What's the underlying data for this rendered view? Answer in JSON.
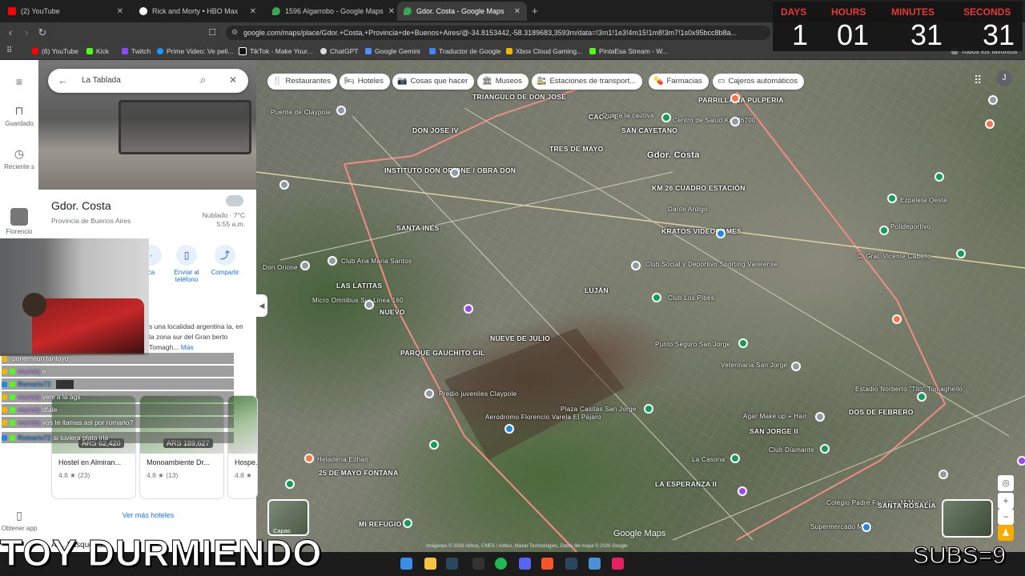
{
  "tabs": [
    {
      "title": "(2) YouTube",
      "color": "#ff0000"
    },
    {
      "title": "Rick and Morty • HBO Max",
      "color": "#ffffff"
    },
    {
      "title": "1596 Algarrobo - Google Maps",
      "color": "#34a853"
    },
    {
      "title": "Gdor. Costa - Google Maps",
      "color": "#34a853"
    }
  ],
  "address": "google.com/maps/place/Gdor.+Costa,+Provincia+de+Buenos+Aires/@-34.8153442,-58.3189683,3593m/data=!3m1!1e3!4m15!1m8!3m7!1s0x95bcc8b8a...",
  "bookmarks": [
    "(6) YouTube",
    "Kick",
    "Twitch",
    "Prime Video: Ve peli...",
    "TikTok - Make Your...",
    "ChatGPT",
    "Google Gemini",
    "Traductor de Google",
    "Xbox Cloud Gaming...",
    "PintaEsa Stream - W..."
  ],
  "all_bookmarks": "Todos los favoritos",
  "timer": {
    "labels": {
      "days": "DAYS",
      "hours": "HOURS",
      "minutes": "MINUTES",
      "seconds": "SECONDS"
    },
    "values": {
      "days": "1",
      "hours": "01",
      "minutes": "31",
      "seconds": "31"
    }
  },
  "rail": {
    "saved": "Guardado",
    "recent": "Reciente s",
    "florencio": "Florencio",
    "get_app": "Obtener app"
  },
  "search": {
    "value": "La Tablada"
  },
  "place": {
    "title": "Gdor. Costa",
    "subtitle": "Provincia de Buenos Aires",
    "weather": "Nublado · 7°C",
    "time": "5:55 a.m."
  },
  "actions": {
    "send": "Enviar al teléfono",
    "share": "Compartir",
    "partial": "ca"
  },
  "description": "s una localidad argentina la, en la zona sur del Gran berto Tomagh...",
  "description_more": "Más",
  "hotels": [
    {
      "name": "Hostel en Almiran...",
      "rating": "4.8 ★ (23)",
      "price": "ARS 62,420"
    },
    {
      "name": "Monoambiente Dr...",
      "rating": "4.8 ★ (13)",
      "price": "ARS 189,627"
    },
    {
      "name": "Hospe...",
      "rating": "4.8 ★",
      "price": ""
    }
  ],
  "more_hotels": "Ver más hoteles",
  "also_search": "Al... búsquedas",
  "chat": [
    {
      "user": "",
      "msg": "ponemeun tantoyo"
    },
    {
      "user": "mariabj",
      "msg": "e"
    },
    {
      "user": "Romario72",
      "msg": ""
    },
    {
      "user": "mariabj",
      "msg": "veni a la ags"
    },
    {
      "user": "mariabj",
      "msg": "dfale"
    },
    {
      "user": "mariabj",
      "msg": "vos te llamas asi por romario?"
    },
    {
      "user": "Romario72",
      "msg": "si tuviera plata iria"
    }
  ],
  "chips": [
    {
      "label": "Restaurantes",
      "icon": "🍴"
    },
    {
      "label": "Hoteles",
      "icon": "🛏"
    },
    {
      "label": "Cosas que hacer",
      "icon": "📷"
    },
    {
      "label": "Museos",
      "icon": "🏛"
    },
    {
      "label": "Estaciones de transport...",
      "icon": "🚉"
    },
    {
      "label": "Farmacias",
      "icon": "💊"
    },
    {
      "label": "Cajeros automáticos",
      "icon": "▭"
    }
  ],
  "map_labels": {
    "triangulo": "TRIANGULO DE DON JOSE",
    "cacupe": "CACUPE",
    "parrilla": "PARRILLA LA PULPERIA",
    "don_jose": "DON JOSE IV",
    "tres_mayo": "TRES DE MAYO",
    "gdor": "Gdor. Costa",
    "san_cayetano": "SAN CAYETANO",
    "instituto": "INSTITUTO DON ORIONE / OBRA DON",
    "km26": "KM 26 CUADRO ESTACIÓN",
    "dante": "Dante Ardigo",
    "santa_ines": "SANTA INÉS",
    "kratos": "KRATOS VIDEOGAMES",
    "don_orione": "Don Orione",
    "club_ana": "Club Ana Maria Santos",
    "las_latitas": "LAS LATITAS",
    "club_social": "Club Social y Deportivo Sporting Varelense",
    "lujan": "LUJÁN",
    "micro": "Micro Omnibus Sur Linea 160",
    "nuevo": "NUEVO",
    "club_pibes": "Club Los Pibes",
    "nueve_julio": "NUEVE DE JULIO",
    "parque": "PARQUE GAUCHITO GIL",
    "punto": "Punto Seguro San Jorge",
    "veterinaria": "Veterinaria San Jorge",
    "predio": "Predio juveniles Claypole",
    "aerodromo": "Aerodromo Florencio Varela El Pájaro",
    "plaza": "Plaza Casitas San Jorge",
    "agar": "Agar Make up + Hair",
    "san_jorge": "SAN JORGE II",
    "estadio": "Estadio Norberto \"Tito\" Tomaghello",
    "heladeria": "Heladeria Eithan",
    "mayo25": "25 DE MAYO FONTANA",
    "la_casona": "La Casona",
    "club_diamante": "Club Diamante",
    "esperanza": "LA ESPERANZA II",
    "dos_febrero": "DOS DE FEBRERO",
    "colegio": "Colegio Padre Faustino M Mennel",
    "santa_rosa": "SANTA ROSALIA",
    "supermercado": "Supermercado Milan",
    "mi_refugio": "MI REFUGIO",
    "vicente": "C. Gral. Vicente Cabello",
    "polideportivo": "Polideportivo",
    "centro_salud": "Centro de Salud Km 26700",
    "quinta": "Quinta la cautiva",
    "puente": "Puente de Claypole",
    "ezpeleta": "Ezpeleta Oeste",
    "guernica": "C. Guernica"
  },
  "layers": "Capas",
  "google_maps": "Google Maps",
  "map_footer": "Imágenes © 2026 Airbus, CNES / Airbus, Maxar Technologies, Datos del mapa © 2026 Google",
  "overlay_text": "TOY DURMIENDO",
  "subs_text": "SUBS=9"
}
